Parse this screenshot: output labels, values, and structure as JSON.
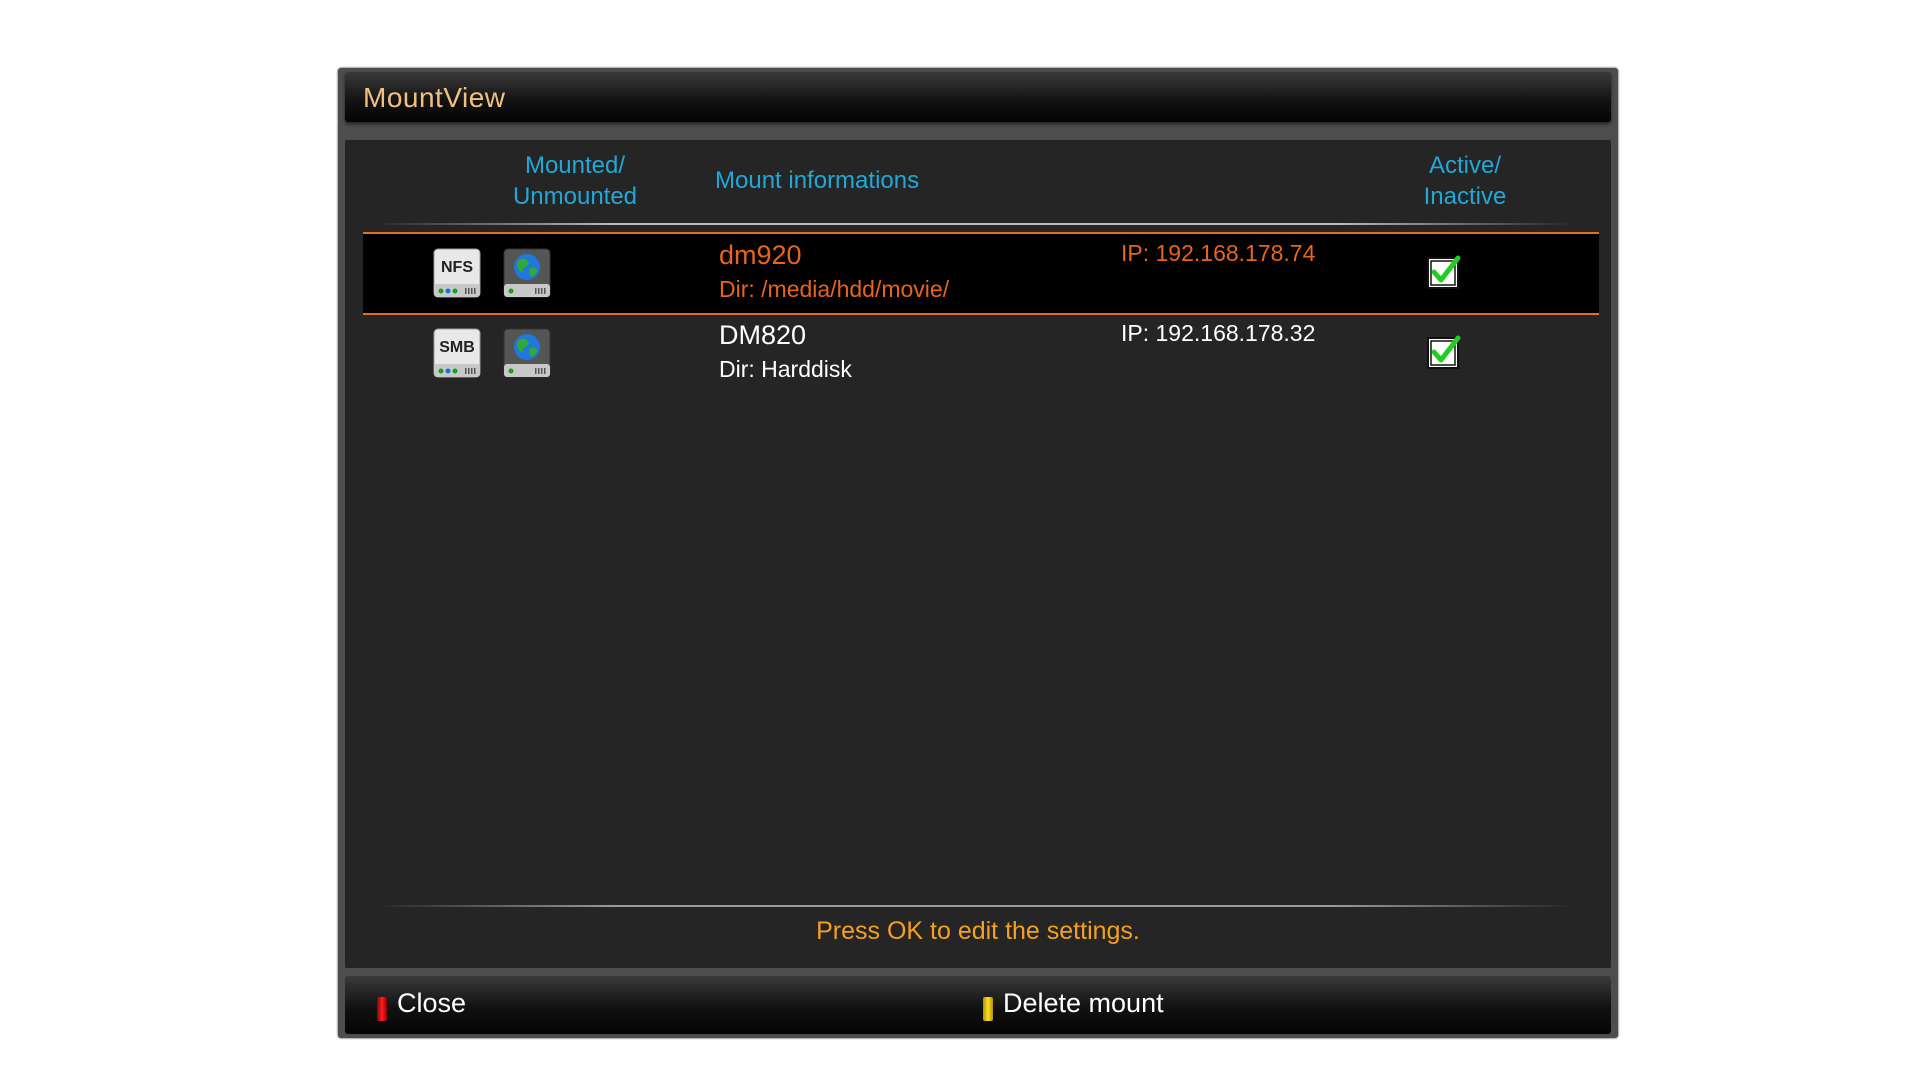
{
  "window": {
    "title": "MountView"
  },
  "columns": {
    "mounted_line1": "Mounted/",
    "mounted_line2": "Unmounted",
    "info": "Mount informations",
    "active_line1": "Active/",
    "active_line2": "Inactive"
  },
  "mounts": [
    {
      "type_icon": "NFS",
      "status_icon": "network-mounted-icon",
      "name": "dm920",
      "dir": "Dir: /media/hdd/movie/",
      "ip": "IP: 192.168.178.74",
      "active": true,
      "selected": true
    },
    {
      "type_icon": "SMB",
      "status_icon": "network-mounted-icon",
      "name": "DM820",
      "dir": "Dir: Harddisk",
      "ip": "IP: 192.168.178.32",
      "active": true,
      "selected": false
    }
  ],
  "hint": "Press OK to edit the settings.",
  "buttons": {
    "red": "Close",
    "yellow": "Delete mount"
  },
  "colors": {
    "title": "#f0c080",
    "column_header": "#20a8d8",
    "selected_text": "#e8641c",
    "hint": "#f5a020",
    "check": "#22cc22"
  }
}
